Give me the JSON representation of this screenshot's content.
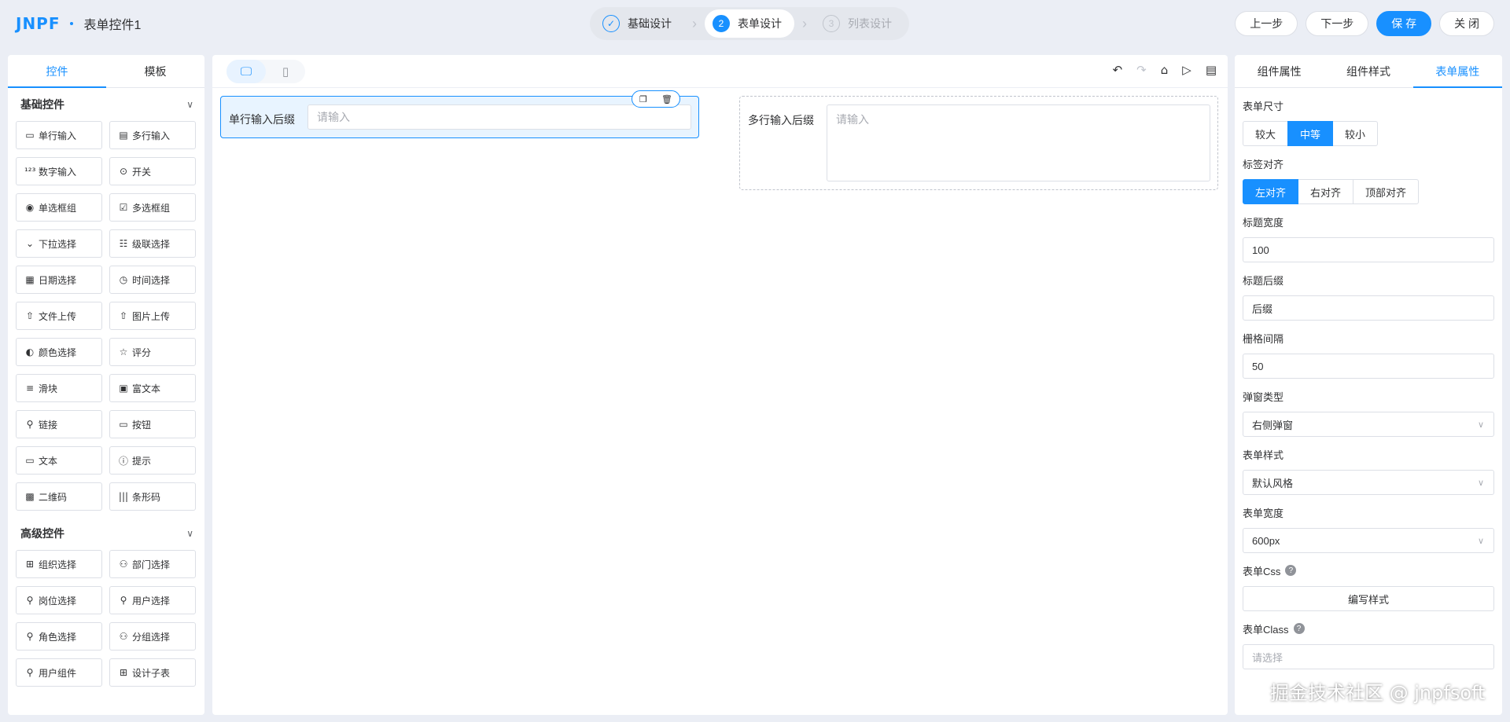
{
  "header": {
    "logo_text": "JNPF",
    "app_title": "表单控件1",
    "steps": [
      {
        "num": "✓",
        "label": "基础设计"
      },
      {
        "num": "2",
        "label": "表单设计"
      },
      {
        "num": "3",
        "label": "列表设计"
      }
    ],
    "buttons": {
      "prev": "上一步",
      "next": "下一步",
      "save": "保 存",
      "close": "关 闭"
    }
  },
  "left": {
    "tabs": [
      "控件",
      "模板"
    ],
    "basic_title": "基础控件",
    "basic_items": [
      {
        "icon": "▭",
        "label": "单行输入"
      },
      {
        "icon": "▤",
        "label": "多行输入"
      },
      {
        "icon": "¹²³",
        "label": "数字输入"
      },
      {
        "icon": "⊙",
        "label": "开关"
      },
      {
        "icon": "◉",
        "label": "单选框组"
      },
      {
        "icon": "☑",
        "label": "多选框组"
      },
      {
        "icon": "⌄",
        "label": "下拉选择"
      },
      {
        "icon": "☷",
        "label": "级联选择"
      },
      {
        "icon": "▦",
        "label": "日期选择"
      },
      {
        "icon": "◷",
        "label": "时间选择"
      },
      {
        "icon": "⇧",
        "label": "文件上传"
      },
      {
        "icon": "⇧",
        "label": "图片上传"
      },
      {
        "icon": "◐",
        "label": "颜色选择"
      },
      {
        "icon": "☆",
        "label": "评分"
      },
      {
        "icon": "≡",
        "label": "滑块"
      },
      {
        "icon": "▣",
        "label": "富文本"
      },
      {
        "icon": "⚲",
        "label": "链接"
      },
      {
        "icon": "▭",
        "label": "按钮"
      },
      {
        "icon": "▭",
        "label": "文本"
      },
      {
        "icon": "ⓘ",
        "label": "提示"
      },
      {
        "icon": "▩",
        "label": "二维码"
      },
      {
        "icon": "|||",
        "label": "条形码"
      }
    ],
    "advanced_title": "高级控件",
    "advanced_items": [
      {
        "icon": "⊞",
        "label": "组织选择"
      },
      {
        "icon": "⚇",
        "label": "部门选择"
      },
      {
        "icon": "⚲",
        "label": "岗位选择"
      },
      {
        "icon": "⚲",
        "label": "用户选择"
      },
      {
        "icon": "⚲",
        "label": "角色选择"
      },
      {
        "icon": "⚇",
        "label": "分组选择"
      },
      {
        "icon": "⚲",
        "label": "用户组件"
      },
      {
        "icon": "⊞",
        "label": "设计子表"
      }
    ]
  },
  "canvas": {
    "tools": [
      "↶",
      "↷",
      "⌂",
      "▷",
      "▤"
    ],
    "field1": {
      "label": "单行输入后缀",
      "placeholder": "请输入",
      "actions": [
        "❐",
        "🗑"
      ]
    },
    "field2": {
      "label": "多行输入后缀",
      "placeholder": "请输入"
    }
  },
  "right": {
    "tabs": [
      "组件属性",
      "组件样式",
      "表单属性"
    ],
    "form_size": {
      "label": "表单尺寸",
      "options": [
        "较大",
        "中等",
        "较小"
      ]
    },
    "label_align": {
      "label": "标签对齐",
      "options": [
        "左对齐",
        "右对齐",
        "顶部对齐"
      ]
    },
    "label_width": {
      "label": "标题宽度",
      "value": "100"
    },
    "label_suffix": {
      "label": "标题后缀",
      "value": "后缀"
    },
    "gutter": {
      "label": "栅格间隔",
      "value": "50"
    },
    "popup_type": {
      "label": "弹窗类型",
      "value": "右侧弹窗"
    },
    "form_style": {
      "label": "表单样式",
      "value": "默认风格"
    },
    "form_width": {
      "label": "表单宽度",
      "value": "600px"
    },
    "form_css": {
      "label": "表单Css",
      "button": "编写样式"
    },
    "form_class": {
      "label": "表单Class",
      "placeholder": "请选择"
    }
  },
  "watermark": "掘金技术社区 @ jnpfsoft",
  "colors": {
    "accent": "#1890ff",
    "background": "#ebeef5"
  }
}
